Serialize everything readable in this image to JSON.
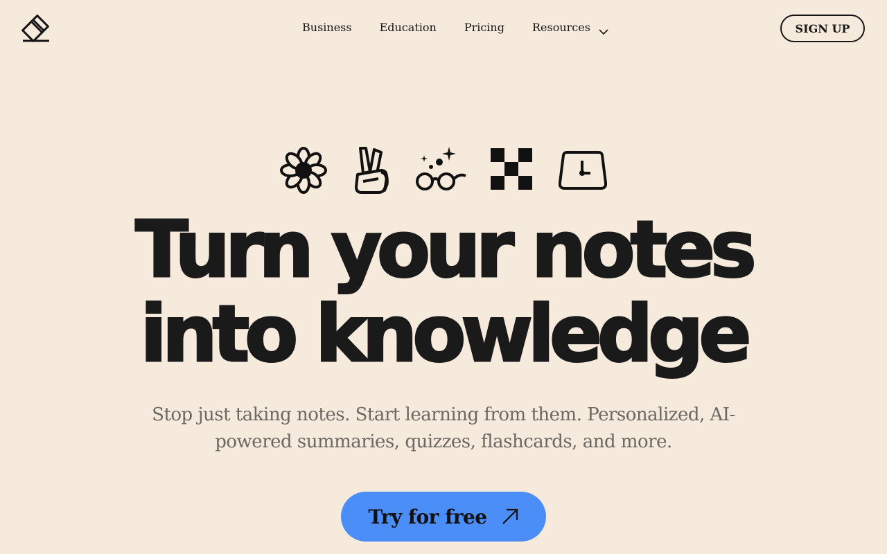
{
  "nav": {
    "logo_icon": "notebook-pencil-logo-icon",
    "items": [
      {
        "label": "Business"
      },
      {
        "label": "Education"
      },
      {
        "label": "Pricing"
      },
      {
        "label": "Resources",
        "icon": "chevron-down-icon"
      }
    ],
    "signup_label": "SIGN UP"
  },
  "hero": {
    "icons": [
      "flower-icon",
      "peace-hand-icon",
      "sparkle-glasses-icon",
      "checkerboard-icon",
      "clock-icon"
    ],
    "headline_line1": "Turn your notes",
    "headline_line2": "into knowledge",
    "subtitle": "Stop just taking notes. Start learning from them. Personalized, AI-powered summaries, quizzes, flashcards, and more.",
    "cta_label": "Try for free",
    "cta_icon": "arrow-up-right-icon"
  },
  "colors": {
    "background": "#F5EADB",
    "text": "#161616",
    "muted_text": "#6B6762",
    "accent": "#4B8EF7"
  }
}
